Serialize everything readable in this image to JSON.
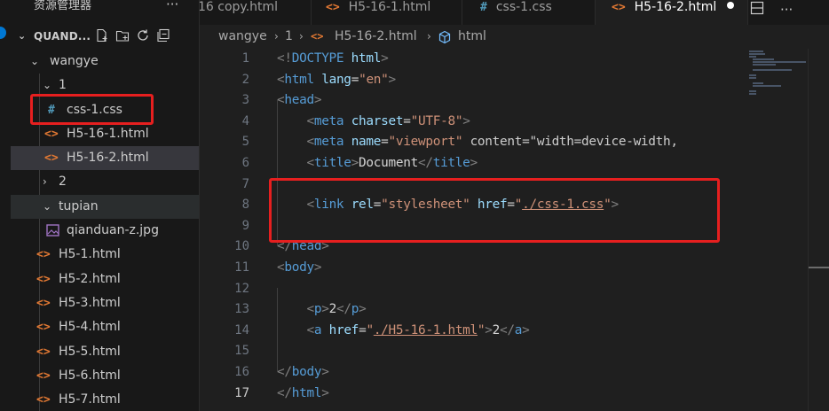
{
  "sidebar": {
    "title": "资源管理器",
    "more_label": "···",
    "root": "QUAND...",
    "items": [
      {
        "label": "wangye",
        "kind": "folder",
        "expanded": true,
        "depth": 1
      },
      {
        "label": "1",
        "kind": "folder",
        "expanded": true,
        "depth": 2
      },
      {
        "label": "css-1.css",
        "kind": "css",
        "depth": 3,
        "icon": "#"
      },
      {
        "label": "H5-16-1.html",
        "kind": "html",
        "depth": 3,
        "icon": "<>"
      },
      {
        "label": "H5-16-2.html",
        "kind": "html",
        "depth": 3,
        "icon": "<>",
        "selected": true
      },
      {
        "label": "2",
        "kind": "folder",
        "expanded": false,
        "depth": 2
      },
      {
        "label": "tupian",
        "kind": "folder",
        "expanded": true,
        "depth": 2,
        "selected": true
      },
      {
        "label": "qianduan-z.jpg",
        "kind": "image",
        "depth": 3
      },
      {
        "label": "H5-1.html",
        "kind": "html",
        "depth": 2,
        "icon": "<>"
      },
      {
        "label": "H5-2.html",
        "kind": "html",
        "depth": 2,
        "icon": "<>"
      },
      {
        "label": "H5-3.html",
        "kind": "html",
        "depth": 2,
        "icon": "<>"
      },
      {
        "label": "H5-4.html",
        "kind": "html",
        "depth": 2,
        "icon": "<>"
      },
      {
        "label": "H5-5.html",
        "kind": "html",
        "depth": 2,
        "icon": "<>"
      },
      {
        "label": "H5-6.html",
        "kind": "html",
        "depth": 2,
        "icon": "<>"
      },
      {
        "label": "H5-7.html",
        "kind": "html",
        "depth": 2,
        "icon": "<>"
      }
    ]
  },
  "tabs": [
    {
      "label": "16 copy.html",
      "icon": "",
      "active": false
    },
    {
      "label": "H5-16-1.html",
      "icon": "<>",
      "active": false
    },
    {
      "label": "css-1.css",
      "icon": "#",
      "active": false
    },
    {
      "label": "H5-16-2.html",
      "icon": "<>",
      "active": true,
      "dirty": true
    }
  ],
  "breadcrumb": [
    "wangye",
    "1",
    "H5-16-2.html",
    "html"
  ],
  "editor": {
    "current_line": 17,
    "lines": [
      {
        "n": "1",
        "code": "<!DOCTYPE html>"
      },
      {
        "n": "2",
        "code": "<html lang=\"en\">"
      },
      {
        "n": "3",
        "code": "<head>"
      },
      {
        "n": "4",
        "code": "    <meta charset=\"UTF-8\">"
      },
      {
        "n": "5",
        "code": "    <meta name=\"viewport\" content=\"width=device-width,"
      },
      {
        "n": "6",
        "code": "    <title>Document</title>"
      },
      {
        "n": "7",
        "code": ""
      },
      {
        "n": "8",
        "code": "    <link rel=\"stylesheet\" href=\"./css-1.css\">"
      },
      {
        "n": "9",
        "code": ""
      },
      {
        "n": "10",
        "code": "</head>"
      },
      {
        "n": "11",
        "code": "<body>"
      },
      {
        "n": "12",
        "code": ""
      },
      {
        "n": "13",
        "code": "    <p>2</p>"
      },
      {
        "n": "14",
        "code": "    <a href=\"./H5-16-1.html\">2</a>"
      },
      {
        "n": "15",
        "code": ""
      },
      {
        "n": "16",
        "code": "</body>"
      },
      {
        "n": "17",
        "code": "</html>"
      }
    ]
  },
  "colors": {
    "tag": "#569cd6",
    "attribute": "#9cdcfe",
    "string": "#ce9178",
    "highlight_box": "#e61f1f",
    "html_icon": "#e37933",
    "css_icon": "#519aba"
  }
}
